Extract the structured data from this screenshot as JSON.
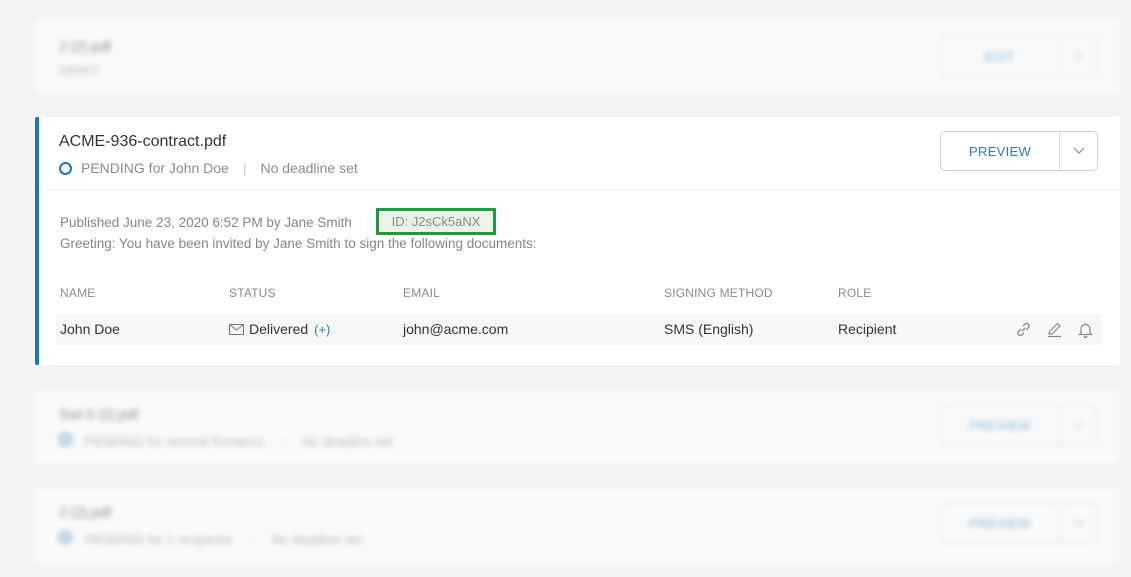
{
  "cards_blurred": [
    {
      "title": "2 (2).pdf",
      "subtitle": "DRAFT",
      "button": "EDIT"
    },
    {
      "title": "Swl-3 (2).pdf",
      "status": "PENDING for  several Renanco",
      "deadline": "No deadline set",
      "button": "PREVIEW"
    },
    {
      "title": "2 (2).pdf",
      "status": "PENDING for 1 recipients",
      "deadline": "No deadline set",
      "button": "PREVIEW"
    }
  ],
  "document": {
    "title": "ACME-936-contract.pdf",
    "status": "PENDING for John Doe",
    "deadline": "No deadline set",
    "preview_label": "PREVIEW",
    "published": "Published June 23, 2020 6:52 PM by Jane Smith",
    "id_label": "ID: J2sCk5aNX",
    "greeting": "Greeting: You have been invited by Jane Smith to sign the following documents:",
    "columns": [
      "NAME",
      "STATUS",
      "EMAIL",
      "SIGNING METHOD",
      "ROLE"
    ],
    "recipient": {
      "name": "John Doe",
      "status": "Delivered",
      "status_more": "(+)",
      "email": "john@acme.com",
      "signing_method": "SMS (English)",
      "role": "Recipient"
    },
    "icons": [
      "link-icon",
      "pencil-icon",
      "bell-icon"
    ]
  },
  "colors": {
    "accent": "#1b75bb",
    "highlight": "#1e9b3c",
    "button_text": "#2d7bb3"
  }
}
